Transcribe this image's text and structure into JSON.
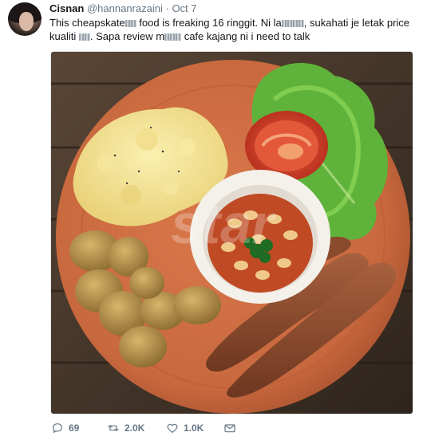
{
  "tweet": {
    "author": {
      "name": "Cisnan",
      "handle": "@hannanrazaini"
    },
    "separator": "·",
    "date": "Oct 7",
    "text_segments": [
      "This cheapskate",
      "food is freaking 16 ringgit. Ni la",
      ", sukahati je letak price kualiti",
      ". Sapa review m",
      "cafe kajang ni i need to talk"
    ],
    "media": {
      "watermark": "star",
      "icon": "breakfast-plate-photo"
    },
    "actions": {
      "reply": {
        "icon": "reply-icon",
        "count": "69"
      },
      "retweet": {
        "icon": "retweet-icon",
        "count": "2.0K"
      },
      "like": {
        "icon": "heart-icon",
        "count": "1.0K"
      },
      "dm": {
        "icon": "envelope-icon"
      }
    }
  },
  "colors": {
    "text": "#14171a",
    "muted": "#657786",
    "plate": "#c8683e",
    "table": "#4a3a2e"
  }
}
